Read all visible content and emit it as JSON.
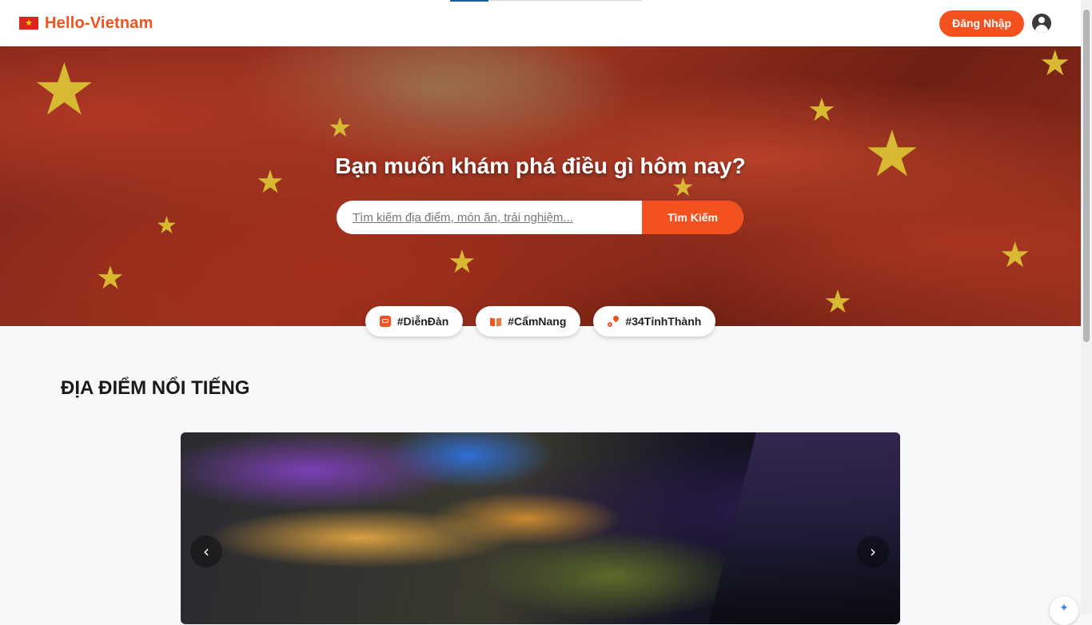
{
  "header": {
    "brand_name": "Hello-Vietnam",
    "brand_flag": "vietnam-flag",
    "login_label": "Đăng Nhập",
    "account_icon": "account-circle-icon"
  },
  "hero": {
    "title": "Bạn muốn khám phá điều gì hôm nay?",
    "search_placeholder": "Tìm kiếm địa điểm, món ăn, trải nghiệm...",
    "search_button": "Tìm Kiếm",
    "chips": [
      {
        "label": "#DiễnĐàn",
        "icon": "forum-icon"
      },
      {
        "label": "#CẩmNang",
        "icon": "guidebook-icon"
      },
      {
        "label": "#34TỉnhThành",
        "icon": "route-icon"
      }
    ]
  },
  "featured": {
    "section_title": "ĐỊA ĐIỂM NỔI TIẾNG",
    "prev_icon": "chevron-left-icon",
    "next_icon": "chevron-right-icon"
  },
  "colors": {
    "accent": "#f4511e",
    "flag_red": "#da251d",
    "flag_star": "#ffde00",
    "page_bg": "#f7f8fa"
  }
}
